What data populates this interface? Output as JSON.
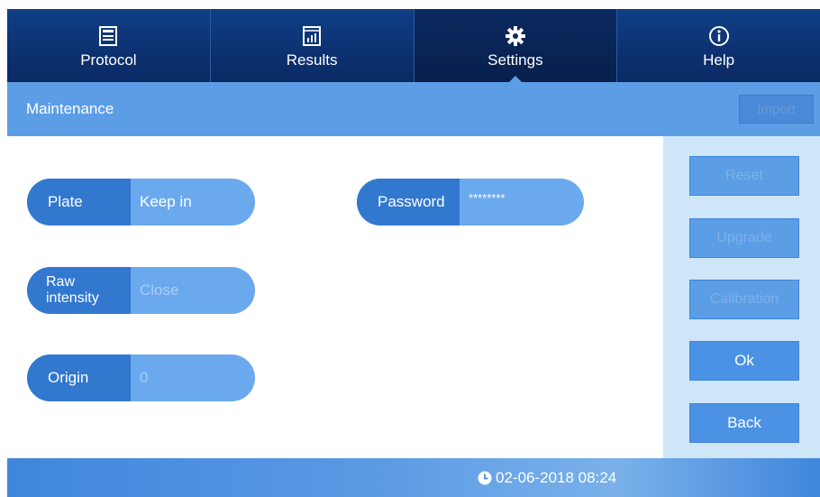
{
  "nav": {
    "tabs": [
      {
        "label": "Protocol",
        "icon": "window-icon",
        "active": false
      },
      {
        "label": "Results",
        "icon": "bar-chart-icon",
        "active": false
      },
      {
        "label": "Settings",
        "icon": "gear-icon",
        "active": true
      },
      {
        "label": "Help",
        "icon": "info-icon",
        "active": false
      }
    ]
  },
  "section": {
    "title": "Maintenance",
    "import_label": "Import"
  },
  "settings": {
    "plate": {
      "label": "Plate",
      "value": "Keep in"
    },
    "raw_intensity": {
      "label_line1": "Raw",
      "label_line2": "intensity",
      "value": "Close"
    },
    "origin": {
      "label": "Origin",
      "value": "0"
    },
    "password": {
      "label": "Password",
      "value": "********"
    }
  },
  "actions": {
    "reset": "Reset",
    "upgrade": "Upgrade",
    "calibration": "Calibration",
    "ok": "Ok",
    "back": "Back"
  },
  "footer": {
    "datetime": "02-06-2018 08:24",
    "icon": "clock-icon"
  },
  "colors": {
    "nav_bg": "#0d3272",
    "section_bg": "#5b9ee6",
    "pill_key": "#3278cf",
    "pill_value": "#6aa9ee",
    "panel_bg": "#cfe6f8"
  }
}
